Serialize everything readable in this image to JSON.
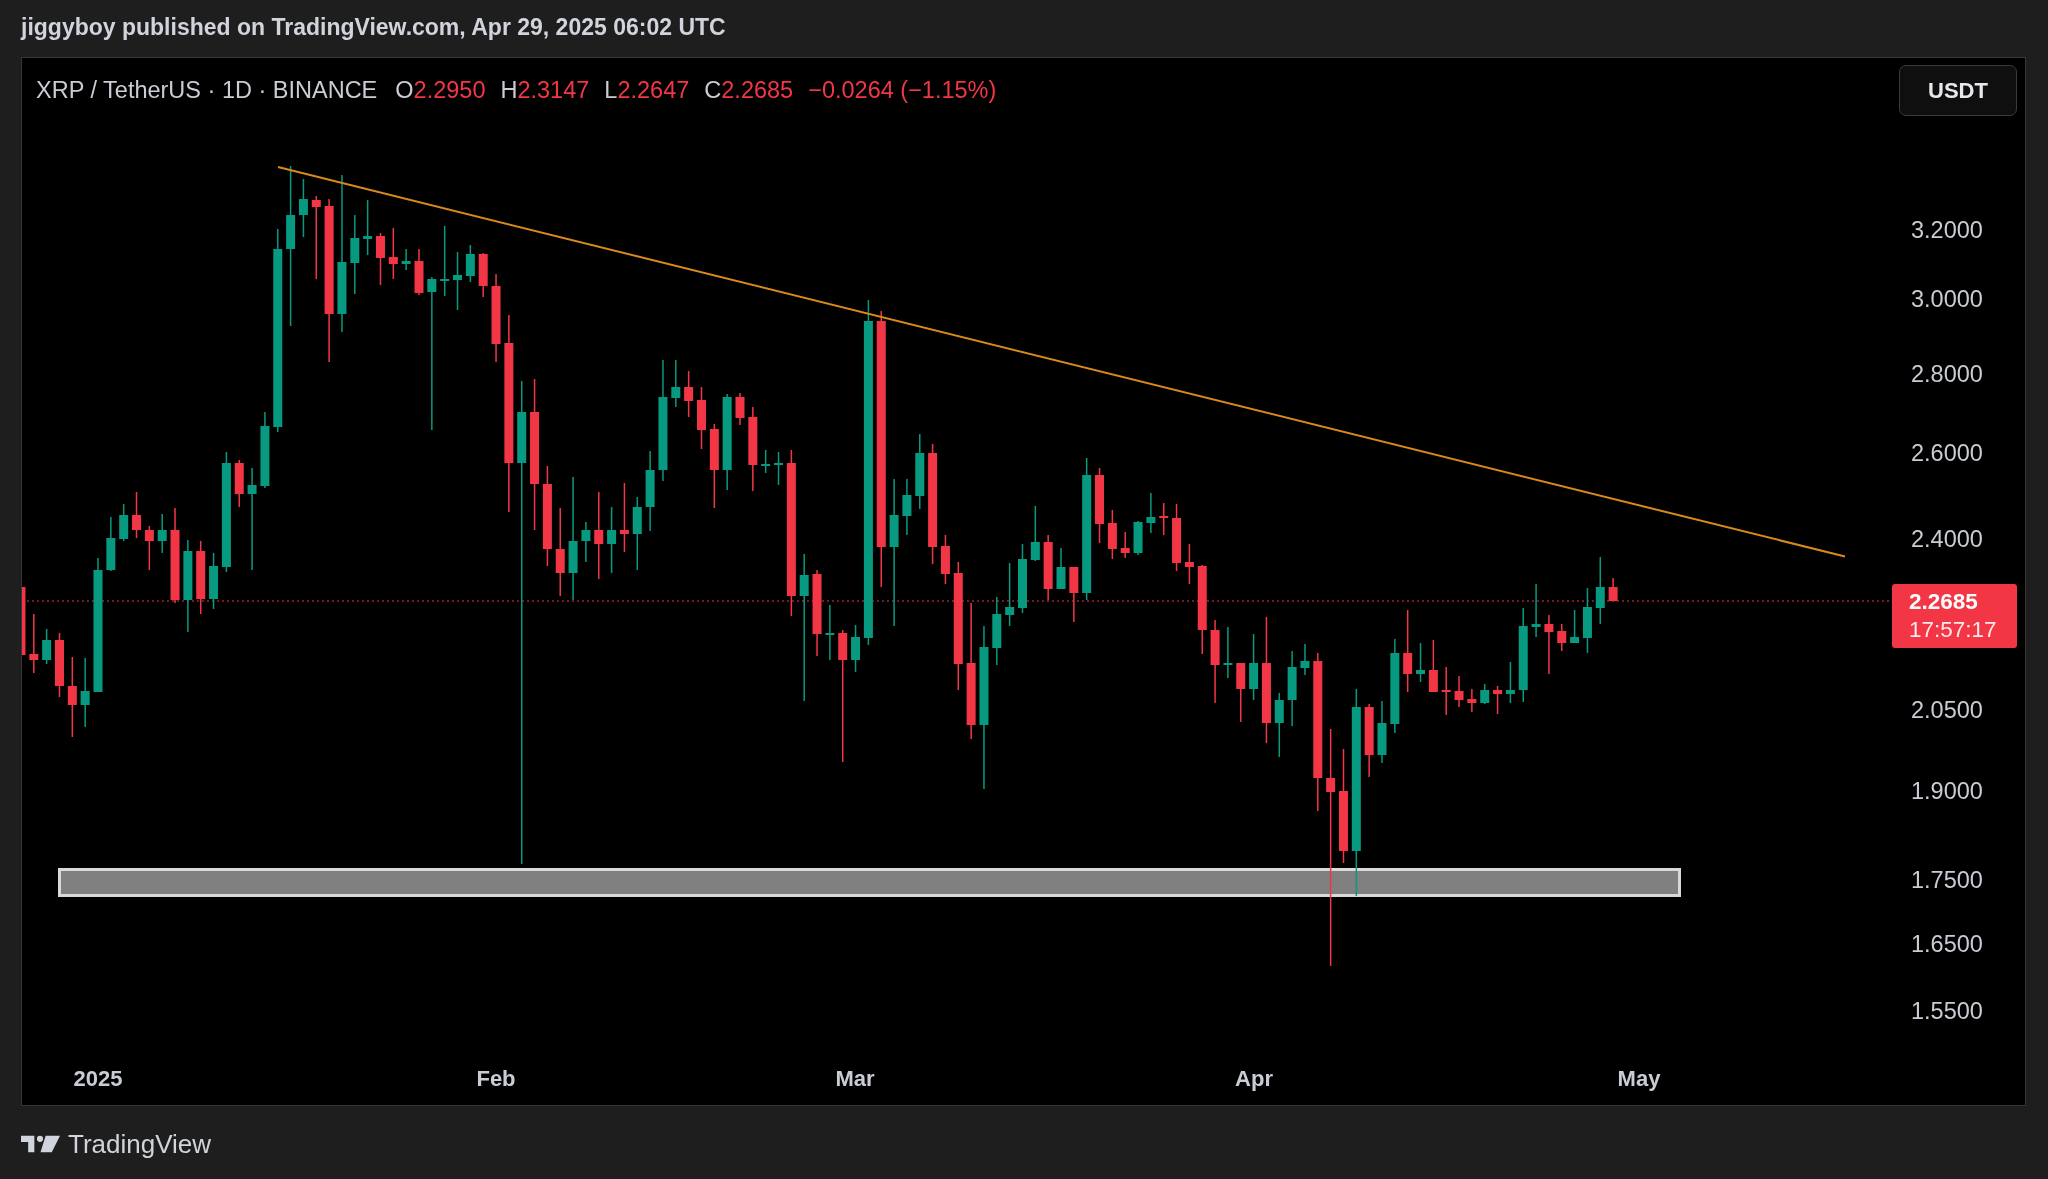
{
  "header": {
    "text": "jiggyboy published on TradingView.com, Apr 29, 2025 06:02 UTC"
  },
  "legend": {
    "symbol": "XRP / TetherUS · 1D · BINANCE",
    "values": [
      {
        "label": "O",
        "value": "2.2950"
      },
      {
        "label": "H",
        "value": "2.3147"
      },
      {
        "label": "L",
        "value": "2.2647"
      },
      {
        "label": "C",
        "value": "2.2685"
      }
    ],
    "change": "−0.0264 (−1.15%)"
  },
  "currency_button": {
    "label": "USDT"
  },
  "price_axis": {
    "ticks": [
      "3.2000",
      "3.0000",
      "2.8000",
      "2.6000",
      "2.4000",
      "2.0500",
      "1.9000",
      "1.7500",
      "1.6500",
      "1.5500"
    ],
    "last_price": {
      "value": "2.2685",
      "countdown": "17:57:17"
    }
  },
  "time_axis": {
    "labels": [
      "2025",
      "Feb",
      "Mar",
      "Apr",
      "May"
    ]
  },
  "footer": {
    "brand": "TradingView"
  }
}
